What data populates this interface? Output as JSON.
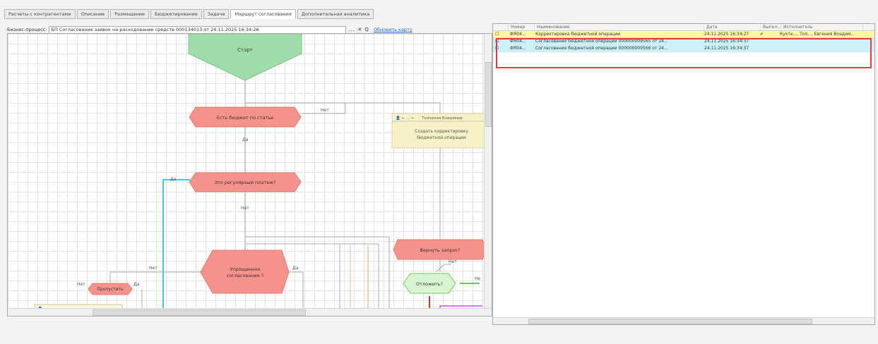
{
  "tabs": [
    "Расчеты с контрагентами",
    "Описание",
    "Размещение",
    "Бюджетирование",
    "Задачи",
    "Маршрут согласования",
    "Дополнительная аналитика"
  ],
  "active_tab": 5,
  "bp": {
    "label": "Бизнес-процесс:",
    "value": "БП Согласование заявок на расходование средств 000134013 от 24.11.2025 16:34:26",
    "buttons": "... ✕ Q",
    "link": "Обновить карту"
  },
  "flow": {
    "start": "Старт",
    "budget_check": "Есть бюджет по статье",
    "no1": "Нет",
    "yes1": "Да",
    "task_user": "Толченая Владимир",
    "task_text_1": "Создать корректировку",
    "task_text_2": "бюджетной операции",
    "recurring": "Это регулярный платеж?",
    "yes2": "Да",
    "no2": "Нет",
    "simplified_1": "Упрощенное",
    "simplified_2": "согласование ?",
    "no3": "Нет",
    "yes3": "Да",
    "return": "Вернуть запрос?",
    "no4": "Нет",
    "postpone": "Отложить?",
    "no5": "Не",
    "skip": "Пропустить",
    "no6": "Нет",
    "yes6": "Да"
  },
  "tasks_table": {
    "columns": [
      "",
      "Номер",
      "Наименование",
      "Дата",
      "Выпол...",
      "Исполнитель"
    ],
    "rows": [
      {
        "icon": "☐",
        "number": "ФЯ04...",
        "name": "Корректировка бюджетной операции",
        "date": "24.11.2025 16:34:27",
        "done": "✔",
        "executor": "Кухте..., Тол..., Евгения Владим..."
      },
      {
        "icon": "☐",
        "number": "ФЯ04...",
        "name": "Согласование бюджетной операции 000000009565 от 24...",
        "date": "24.11.2025 16:34:37",
        "done": "",
        "executor": ""
      },
      {
        "icon": "☐",
        "number": "ФЯ04...",
        "name": "Согласование бюджетной операции 000000009566 от 24...",
        "date": "24.11.2025 16:34:37",
        "done": "",
        "executor": ""
      }
    ]
  },
  "colors": {
    "start": "#9fdcaa",
    "condition": "#f5928c",
    "question_green": "#d8f5d2",
    "task_note": "#f7f1c8",
    "selection": "#e53a3a",
    "row_yellow": "#fff9a5",
    "row_cyan": "#c9f2f9"
  }
}
